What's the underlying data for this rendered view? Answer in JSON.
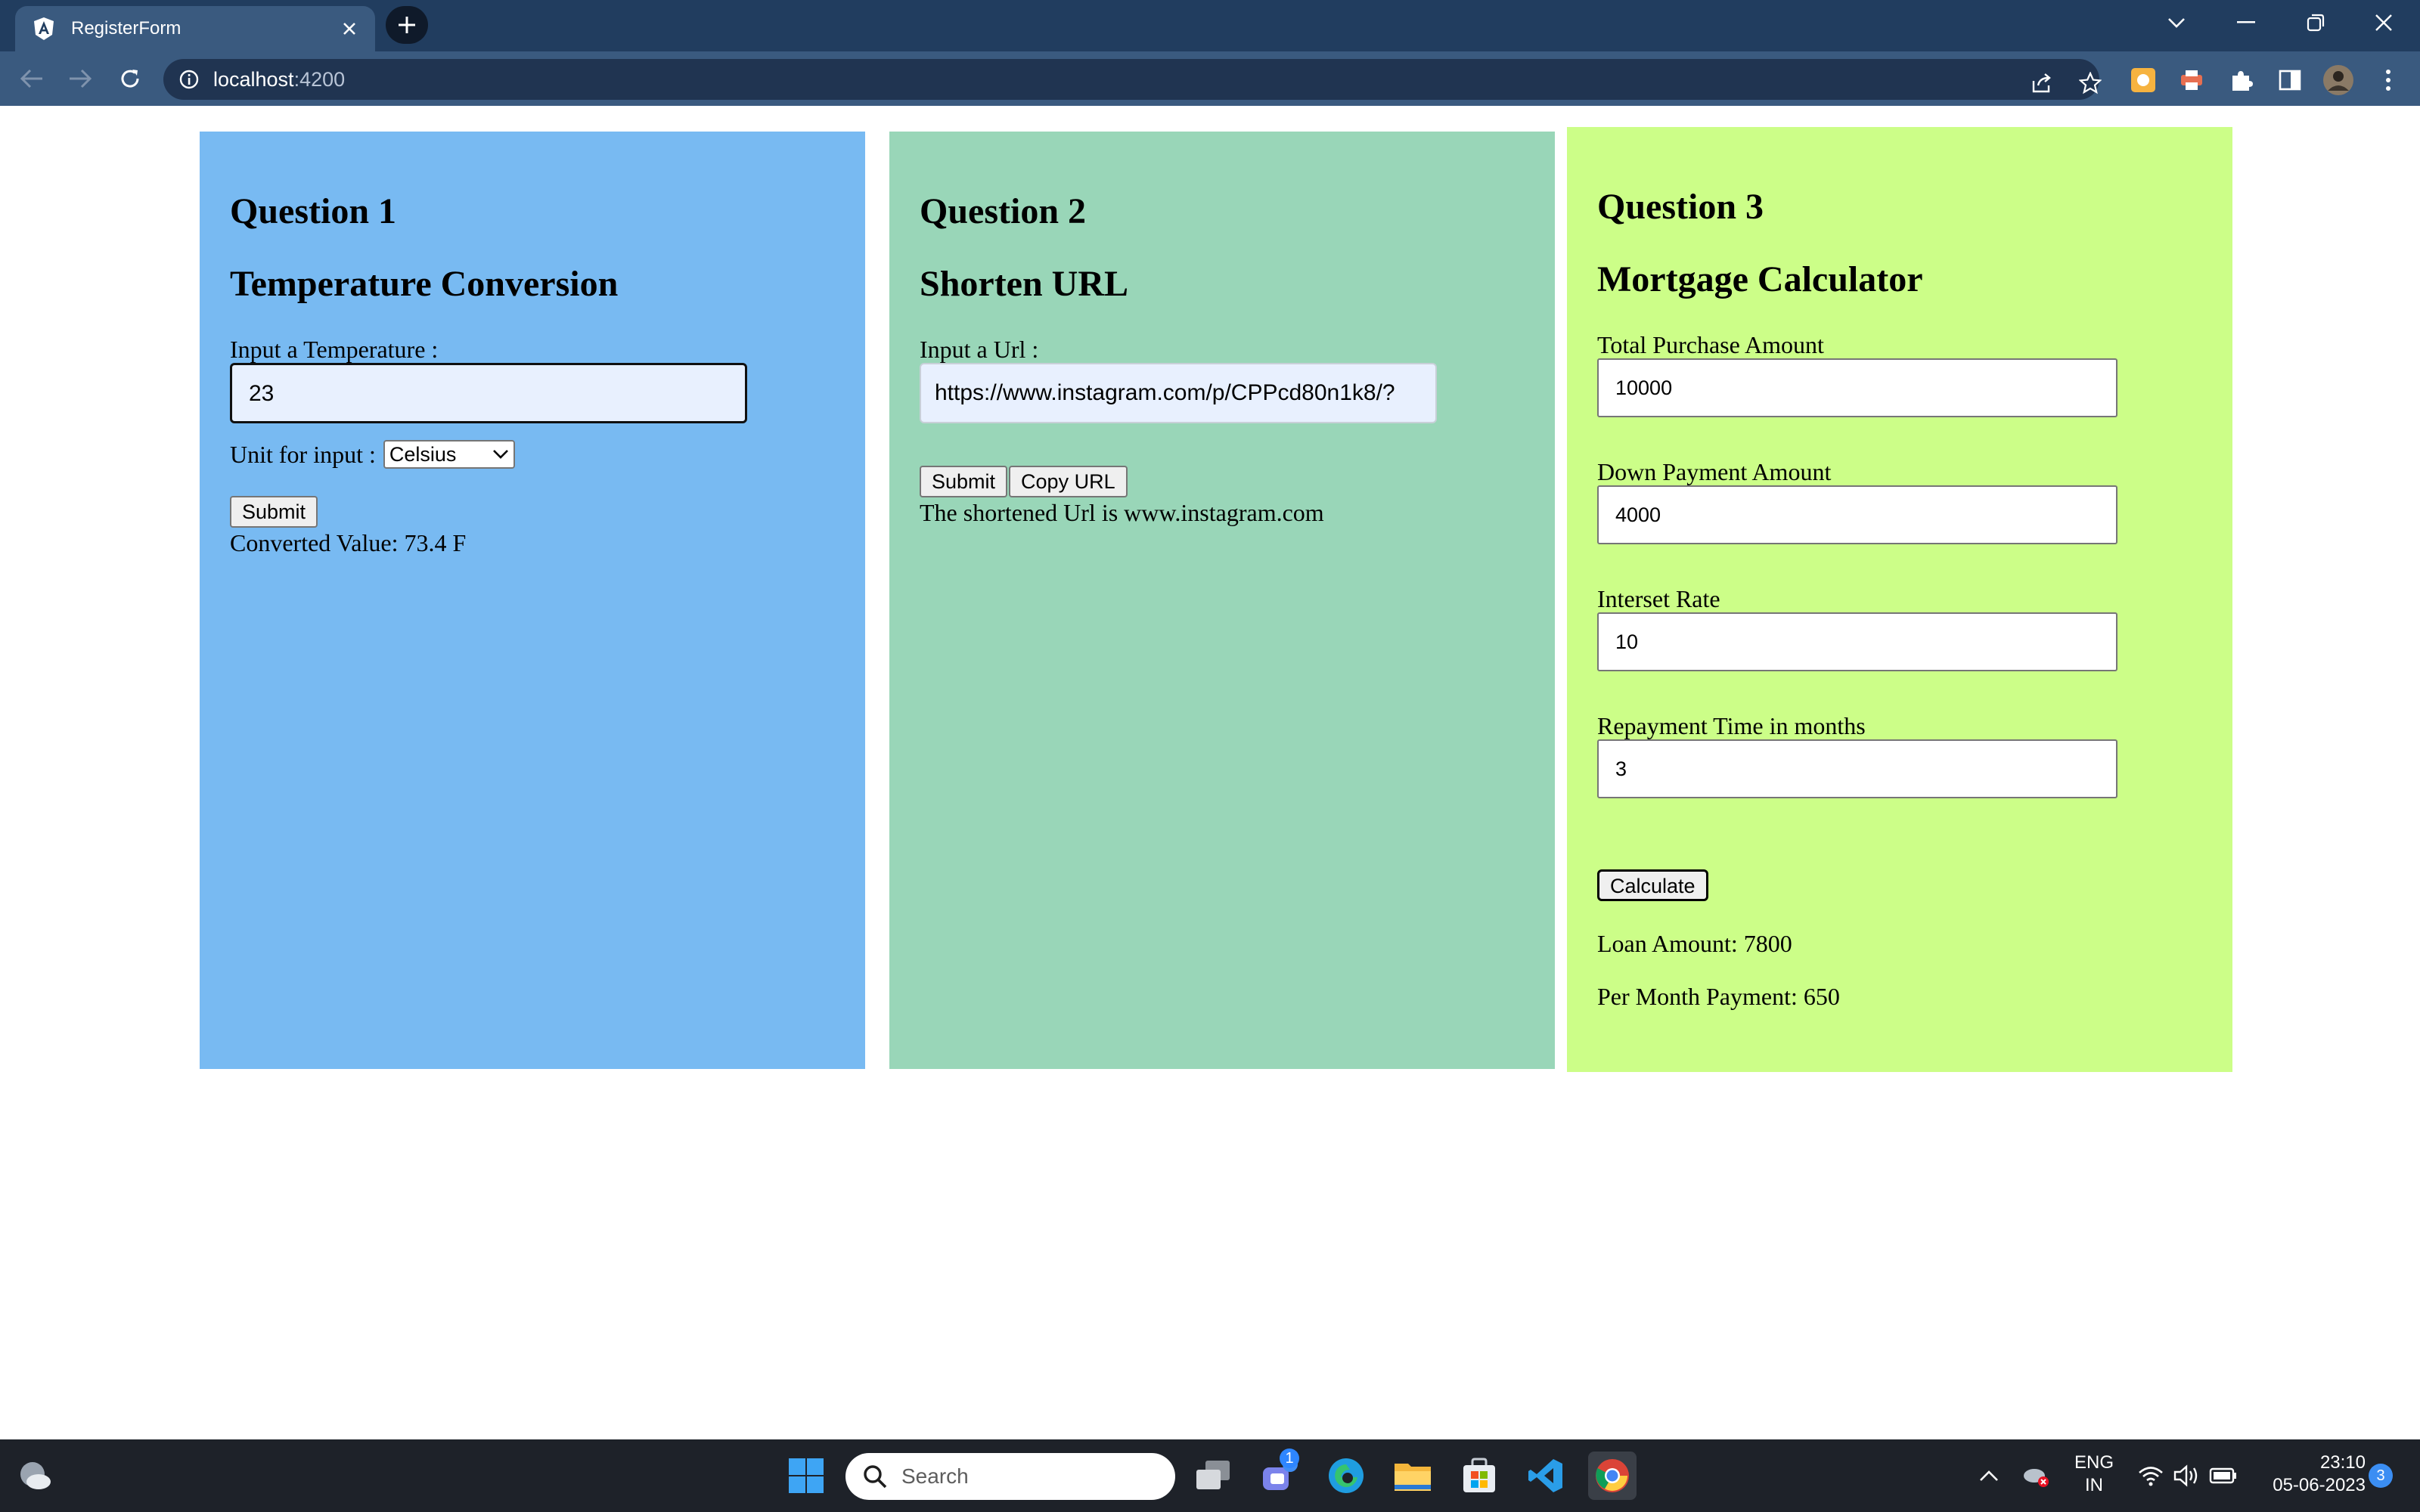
{
  "browser": {
    "tab_title": "RegisterForm",
    "url_host": "localhost",
    "url_port": ":4200"
  },
  "question1": {
    "heading": "Question 1",
    "title": "Temperature Conversion",
    "input_label": "Input a Temperature :",
    "input_value": "23",
    "unit_label": "Unit for input :",
    "unit_selected": "Celsius",
    "submit_label": "Submit",
    "result": "Converted Value: 73.4 F"
  },
  "question2": {
    "heading": "Question 2",
    "title": "Shorten URL",
    "input_label": "Input a Url :",
    "input_value": "https://www.instagram.com/p/CPPcd80n1k8/?",
    "submit_label": "Submit",
    "copy_label": "Copy URL",
    "result": "The shortened Url is www.instagram.com"
  },
  "question3": {
    "heading": "Question 3",
    "title": "Mortgage Calculator",
    "fields": [
      {
        "label": "Total Purchase Amount",
        "value": "10000"
      },
      {
        "label": "Down Payment Amount",
        "value": "4000"
      },
      {
        "label": "Interset Rate",
        "value": "10"
      },
      {
        "label": "Repayment Time in months",
        "value": "3"
      }
    ],
    "calculate_label": "Calculate",
    "loan_amount": "Loan Amount: 7800",
    "per_month": "Per Month Payment: 650"
  },
  "taskbar": {
    "search_placeholder": "Search",
    "chat_badge": "1",
    "lang_line1": "ENG",
    "lang_line2": "IN",
    "time": "23:10",
    "date": "05-06-2023",
    "notification_count": "3"
  },
  "colors": {
    "panel1": "#78baf2",
    "panel2": "#99d6b8",
    "panel3": "#ccfe88",
    "chrome_dark": "#213d5f",
    "chrome_toolbar": "#3a5a7f"
  }
}
